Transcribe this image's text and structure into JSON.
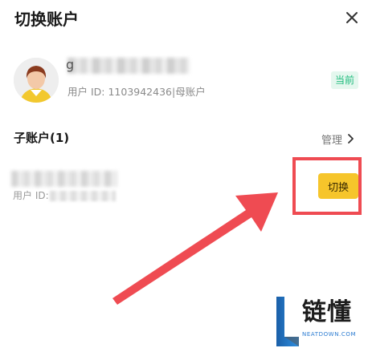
{
  "dialog": {
    "title": "切换账户",
    "close_icon": "close-icon"
  },
  "current_account": {
    "name_initial": "g",
    "user_id_text": "用户 ID: 1103942436|母账户",
    "badge": "当前",
    "badge_color": "#1dbb7c",
    "avatar_icon": "user-avatar-icon"
  },
  "sub_accounts": {
    "section_title": "子账户(1)",
    "manage_label": "管理",
    "manage_icon": "chevron-right-icon",
    "items": [
      {
        "user_id_label": "用户 ID:",
        "switch_label": "切换"
      }
    ]
  },
  "annotation": {
    "arrow_color": "#ef4b52",
    "highlight_color": "#ef4b52"
  },
  "watermark": {
    "text": "链懂",
    "sub": "NEATDOWN.COM",
    "logo_icon": "l-logo-icon"
  },
  "colors": {
    "switch_button": "#f6c52b",
    "accent_green": "#1dbb7c"
  }
}
